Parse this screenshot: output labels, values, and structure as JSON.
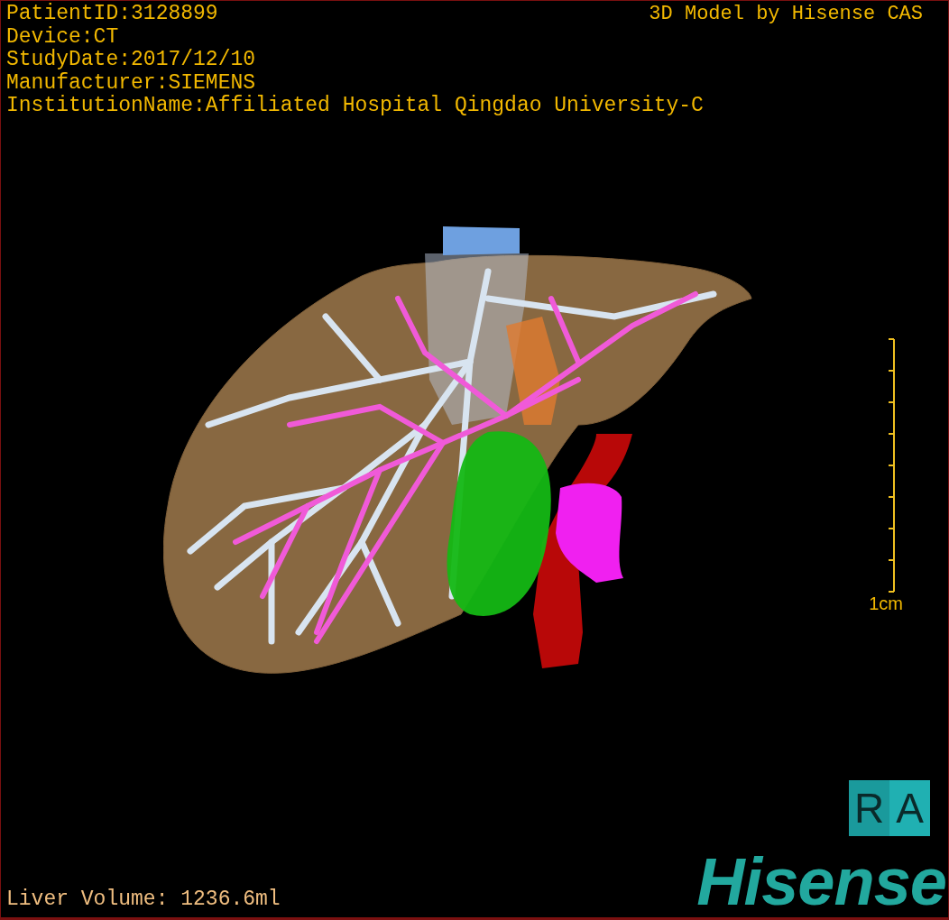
{
  "info_lines": [
    "PatientID:3128899",
    "Device:CT",
    "StudyDate:2017/12/10",
    "Manufacturer:SIEMENS",
    "InstitutionName:Affiliated Hospital Qingdao University-C"
  ],
  "title": "3D Model by Hisense CAS",
  "scale_bar": {
    "label": "1cm"
  },
  "orientation_cube": {
    "faces": [
      "R",
      "A"
    ]
  },
  "liver_volume": "Liver Volume: 1236.6ml",
  "logo": "Hisense"
}
